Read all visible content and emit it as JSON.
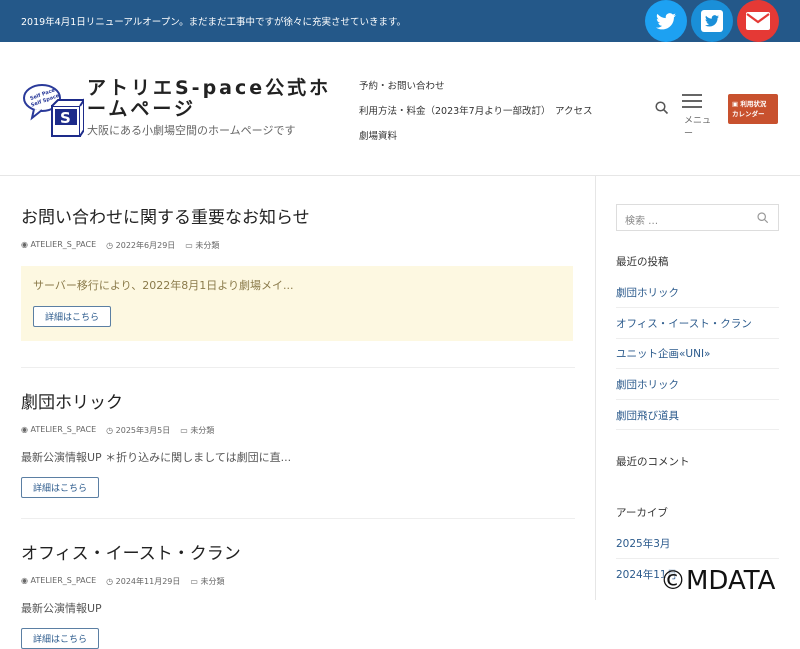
{
  "topbar": {
    "notice": "2019年4月1日リニューアルオープン。まだまだ工事中ですが徐々に充実させていきます。",
    "social": [
      {
        "icon": "twitter-icon",
        "color": "#1da1f2"
      },
      {
        "icon": "twitter-square-icon",
        "color": "#1a8fd8"
      },
      {
        "icon": "email-icon",
        "color": "#e53935"
      }
    ]
  },
  "header": {
    "title": "アトリエS-pace公式ホームページ",
    "tagline": "大阪にある小劇場空間のホームページです",
    "logo_text": "Self Pace Self Space",
    "nav": [
      "予約・お問い合わせ",
      "利用方法・料金（2023年7月より一部改訂）",
      "アクセス",
      "劇場資料"
    ],
    "menu_label": "メニュー",
    "calendar_line1": "利用状況",
    "calendar_line2": "カレンダー"
  },
  "posts": [
    {
      "title": "お問い合わせに関する重要なお知らせ",
      "author": "ATELIER_S_PACE",
      "date": "2022年6月29日",
      "category": "未分類",
      "excerpt": "サーバー移行により、2022年8月1日より劇場メイ...",
      "more": "詳細はこちら"
    },
    {
      "title": "劇団ホリック",
      "author": "ATELIER_S_PACE",
      "date": "2025年3月5日",
      "category": "未分類",
      "excerpt": "最新公演情報UP ＊折り込みに関しましては劇団に直...",
      "more": "詳細はこちら"
    },
    {
      "title": "オフィス・イースト・クラン",
      "author": "ATELIER_S_PACE",
      "date": "2024年11月29日",
      "category": "未分類",
      "excerpt": "最新公演情報UP",
      "more": "詳細はこちら"
    }
  ],
  "sidebar": {
    "search_placeholder": "検索 …",
    "recent_posts_title": "最近の投稿",
    "recent_posts": [
      "劇団ホリック",
      "オフィス・イースト・クラン",
      "ユニット企画«UNI»",
      "劇団ホリック",
      "劇団飛び道具"
    ],
    "recent_comments_title": "最近のコメント",
    "archive_title": "アーカイブ",
    "archives": [
      "2025年3月",
      "2024年11月"
    ]
  },
  "watermark": "©MDATA"
}
